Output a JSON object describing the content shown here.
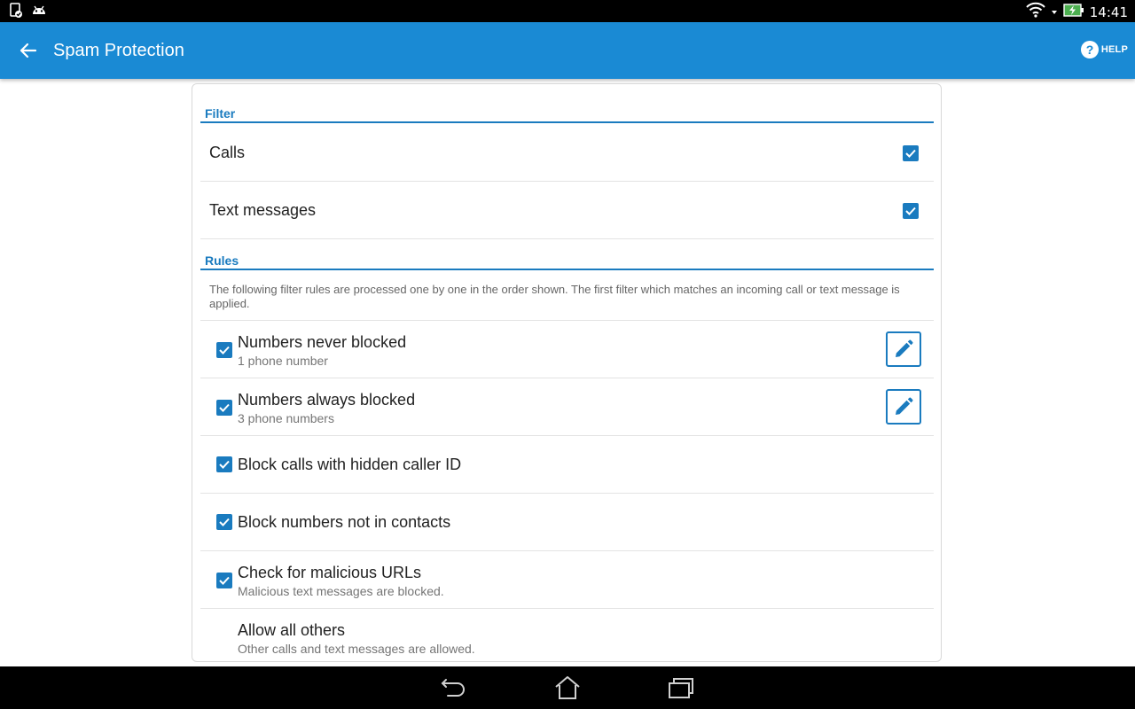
{
  "status_bar": {
    "time": "14:41",
    "left_icons": [
      "clipboard-check-icon",
      "android-debug-icon"
    ],
    "right_icons": [
      "wifi-icon",
      "signal-arrow-icon",
      "battery-charging-icon"
    ]
  },
  "action_bar": {
    "title": "Spam Protection",
    "help_label": "HELP",
    "color": "#1a8ad4"
  },
  "filter_section": {
    "header": "Filter",
    "items": [
      {
        "label": "Calls",
        "checked": true
      },
      {
        "label": "Text messages",
        "checked": true
      }
    ]
  },
  "rules_section": {
    "header": "Rules",
    "description": "The following filter rules are processed one by one in the order shown. The first filter which matches an incoming call or text message is applied.",
    "items": [
      {
        "title": "Numbers never blocked",
        "subtitle": "1 phone number",
        "checked": true,
        "editable": true
      },
      {
        "title": "Numbers always blocked",
        "subtitle": "3 phone numbers",
        "checked": true,
        "editable": true
      },
      {
        "title": "Block calls with hidden caller ID",
        "subtitle": "",
        "checked": true,
        "editable": false
      },
      {
        "title": "Block numbers not in contacts",
        "subtitle": "",
        "checked": true,
        "editable": false
      },
      {
        "title": "Check for malicious URLs",
        "subtitle": "Malicious text messages are blocked.",
        "checked": true,
        "editable": false
      },
      {
        "title": "Allow all others",
        "subtitle": "Other calls and text messages are allowed.",
        "checked": false,
        "editable": false
      }
    ]
  },
  "nav_bar": {
    "buttons": [
      "back-nav-icon",
      "home-nav-icon",
      "recents-nav-icon"
    ]
  },
  "colors": {
    "accent": "#1a7bbf",
    "toolbar": "#1a8ad4"
  }
}
